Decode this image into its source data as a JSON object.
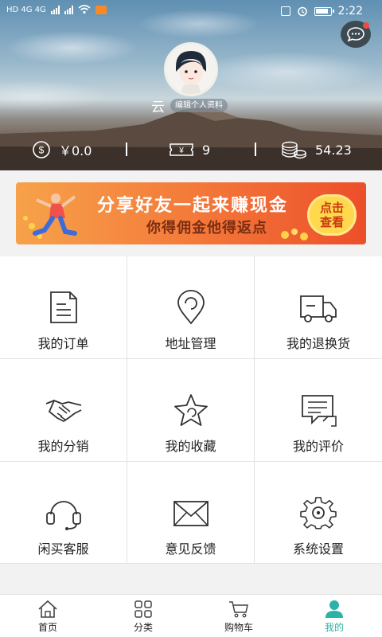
{
  "status_bar": {
    "time": "2:22",
    "left_text": "HD 4G 4G"
  },
  "profile": {
    "username": "云",
    "edit_label": "编辑个人资料"
  },
  "stats": {
    "balance": "￥0.0",
    "coupons": "9",
    "points": "54.23"
  },
  "banner": {
    "title": "分享好友一起来赚现金",
    "subtitle": "你得佣金他得返点",
    "button_line1": "点击",
    "button_line2": "查看"
  },
  "menu": [
    {
      "label": "我的订单",
      "icon": "order-list-icon"
    },
    {
      "label": "地址管理",
      "icon": "location-pin-icon"
    },
    {
      "label": "我的退换货",
      "icon": "delivery-truck-icon"
    },
    {
      "label": "我的分销",
      "icon": "handshake-icon"
    },
    {
      "label": "我的收藏",
      "icon": "star-icon"
    },
    {
      "label": "我的评价",
      "icon": "comment-icon"
    },
    {
      "label": "闲买客服",
      "icon": "headset-icon"
    },
    {
      "label": "意见反馈",
      "icon": "envelope-icon"
    },
    {
      "label": "系统设置",
      "icon": "gear-icon"
    }
  ],
  "tabs": [
    {
      "label": "首页",
      "icon": "home-icon"
    },
    {
      "label": "分类",
      "icon": "category-grid-icon"
    },
    {
      "label": "购物车",
      "icon": "cart-icon"
    },
    {
      "label": "我的",
      "icon": "user-icon",
      "active": true
    }
  ],
  "colors": {
    "accent": "#2ab3a6",
    "banner_start": "#f6a24a",
    "banner_end": "#ec4f2a",
    "badge": "#f04a3f"
  }
}
